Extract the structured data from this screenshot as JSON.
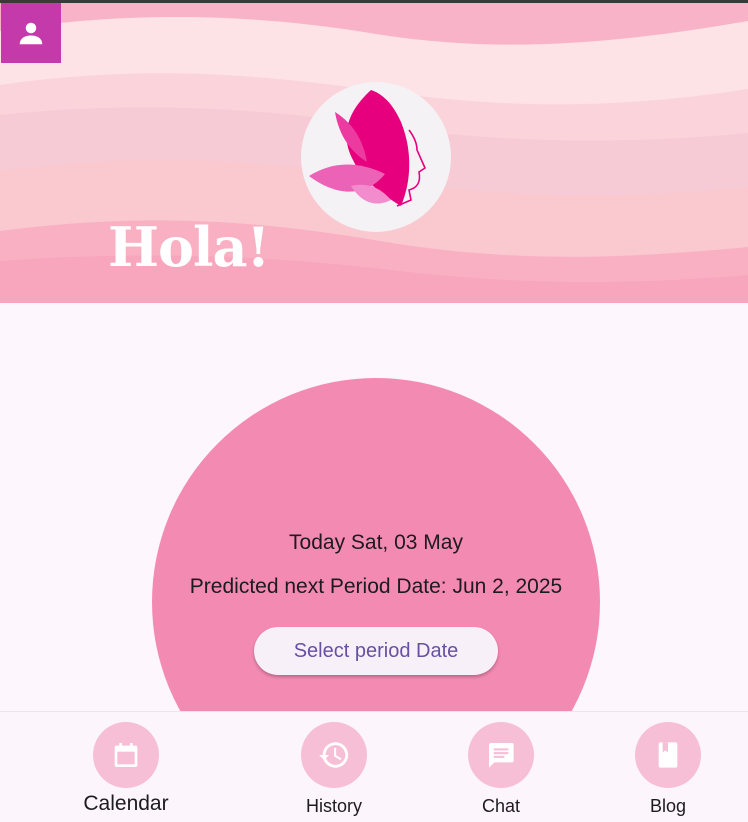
{
  "header": {
    "greeting": "Hola!",
    "profile_icon": "person-icon",
    "logo_icon": "butterfly-woman-logo",
    "colors": {
      "profile_button": "#c43aab",
      "wave_base": "#f9b3c8"
    }
  },
  "main": {
    "today_text": "Today Sat, 03 May",
    "predicted_text": "Predicted next Period Date: Jun 2, 2025",
    "select_button_label": "Select period Date",
    "colors": {
      "circle": "#f38ab2",
      "button_text": "#6750a4"
    }
  },
  "nav": {
    "items": [
      {
        "label": "Calendar",
        "icon": "calendar-icon"
      },
      {
        "label": "History",
        "icon": "history-icon"
      },
      {
        "label": "Chat",
        "icon": "chat-icon"
      },
      {
        "label": "Blog",
        "icon": "book-icon"
      }
    ],
    "colors": {
      "icon_bg": "#f6bfd6",
      "icon_fg": "#ffffff"
    }
  }
}
